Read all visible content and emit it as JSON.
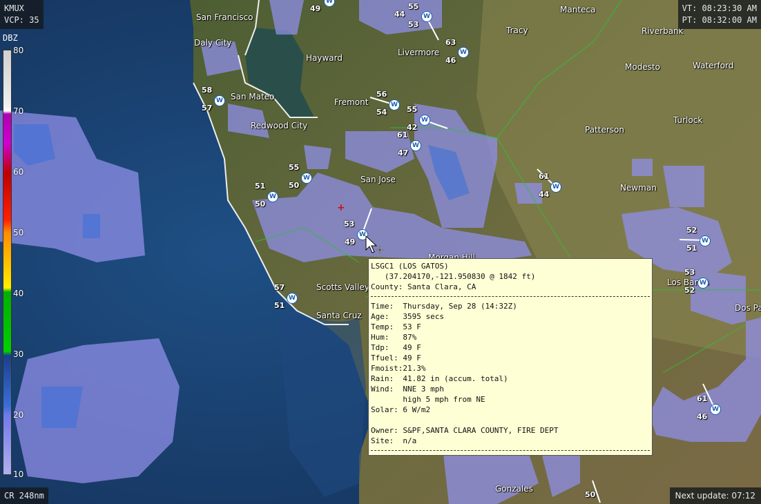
{
  "header": {
    "site": "KMUX",
    "vcp": "VCP: 35",
    "valid_time": "VT: 08:23:30 AM",
    "processed_time": "PT: 08:32:00 AM"
  },
  "legend": {
    "title": "DBZ",
    "ticks": [
      "80",
      "70",
      "60",
      "50",
      "40",
      "30",
      "20",
      "10"
    ]
  },
  "footer": {
    "range": "CR 248nm",
    "next_update": "Next update: 07:12"
  },
  "cities": [
    "San Francisco",
    "Daly City",
    "Hayward",
    "Livermore",
    "Tracy",
    "Manteca",
    "Riverbank",
    "Modesto",
    "Waterford",
    "San Mateo",
    "Fremont",
    "Redwood City",
    "Patterson",
    "Turlock",
    "San Jose",
    "Newman",
    "Morgan Hill",
    "Scotts Valley",
    "Santa Cruz",
    "Los Banos",
    "Dos Palos",
    "Gonzales"
  ],
  "station_values": [
    "49",
    "44",
    "55",
    "53",
    "63",
    "46",
    "58",
    "57",
    "56",
    "54",
    "55",
    "42",
    "61",
    "47",
    "55",
    "51",
    "50",
    "50",
    "53",
    "49",
    "61",
    "44",
    "52",
    "51",
    "53",
    "52",
    "57",
    "51",
    "61",
    "46",
    "50"
  ],
  "station_marker": "W",
  "popup": {
    "station": "LSGC1 (LOS GATOS)",
    "coords": "   (37.204170,-121.950830 @ 1842 ft)",
    "county": "County: Santa Clara, CA",
    "time": "Time:  Thursday, Sep 28 (14:32Z)",
    "age": "Age:   3595 secs",
    "temp": "Temp:  53 F",
    "hum": "Hum:   87%",
    "tdp": "Tdp:   49 F",
    "tfuel": "Tfuel: 49 F",
    "fmoist": "Fmoist:21.3%",
    "rain": "Rain:  41.82 in (accum. total)",
    "wind": "Wind:  NNE 3 mph",
    "wind_gust": "       high 5 mph from NE",
    "solar": "Solar: 6 W/m2",
    "owner": "Owner: S&PF,SANTA CLARA COUNTY, FIRE DEPT",
    "site": "Site:  n/a"
  },
  "colors": {
    "ocean": "#1b3f6b",
    "land": "#5b6a3a",
    "radar": "#8f8fe8",
    "popup_bg": "#ffffd6"
  }
}
